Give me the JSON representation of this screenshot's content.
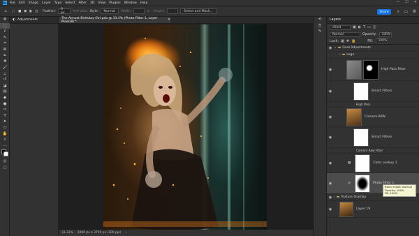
{
  "menu": {
    "app_icon": "Ps",
    "items": [
      "File",
      "Edit",
      "Image",
      "Layer",
      "Type",
      "Select",
      "Filter",
      "3D",
      "View",
      "Plugins",
      "Window",
      "Help"
    ],
    "window_controls": [
      "—",
      "☐",
      "✕"
    ]
  },
  "options": {
    "feather_label": "Feather:",
    "feather_value": "0 px",
    "antialias": "Anti-alias",
    "style_label": "Style:",
    "style_value": "Normal",
    "width_label": "Width:",
    "height_label": "Height:",
    "select_mask": "Select and Mask...",
    "share": "Share"
  },
  "adjustments_panel": {
    "title": "Adjustments"
  },
  "document": {
    "tab_title": "The Almost Birthday Girl.psb @ 33.3% (Photo Filter 1, Layer Mask/8) *",
    "zoom": "33.33%",
    "dimensions": "3000 px x 3750 px (300 ppi)"
  },
  "layers_panel": {
    "title": "Layers",
    "kind_filter": "Kind",
    "blend_mode": "Normal",
    "opacity_label": "Opacity:",
    "opacity_value": "100%",
    "lock_label": "Lock:",
    "fill_label": "Fill:",
    "fill_value": "100%",
    "layers": [
      {
        "name": "Final Adjustments",
        "type": "group"
      },
      {
        "name": "Logo",
        "type": "group"
      },
      {
        "name": "High Pass Filter",
        "type": "layer"
      },
      {
        "name": "Smart Filters",
        "type": "filter"
      },
      {
        "name": "High Pass",
        "type": "filter-item"
      },
      {
        "name": "Camera RAW",
        "type": "layer"
      },
      {
        "name": "Smart Filters",
        "type": "filter"
      },
      {
        "name": "Camera Raw Filter",
        "type": "filter-item"
      },
      {
        "name": "Color Lookup 1",
        "type": "adjustment"
      },
      {
        "name": "Photo Filter 1",
        "type": "adjustment"
      },
      {
        "name": "Texture Overlay",
        "type": "group"
      },
      {
        "name": "Layer 19",
        "type": "layer"
      }
    ],
    "tooltip": [
      "Blend mode: Normal",
      "Opacity: 100%",
      "Fill: 100%"
    ]
  },
  "colors": {
    "accent": "#1473e6",
    "panel": "#323232",
    "background": "#262626"
  }
}
